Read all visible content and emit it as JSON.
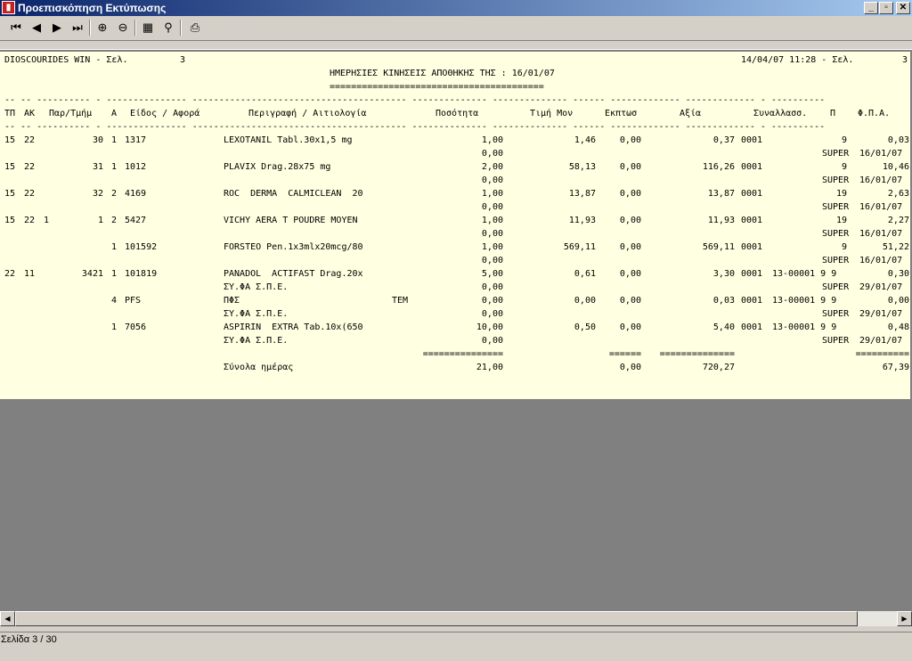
{
  "window": {
    "title": "Προεπισκόπηση Εκτύπωσης",
    "icon": "app-icon",
    "icon_glyph": "▮",
    "controls": {
      "minimize": "_",
      "maximize": "▫",
      "close": "✕"
    }
  },
  "toolbar": {
    "buttons": [
      {
        "name": "first-page-icon",
        "glyph": "⏮"
      },
      {
        "name": "prev-page-icon",
        "glyph": "◀"
      },
      {
        "name": "next-page-icon",
        "glyph": "▶"
      },
      {
        "name": "last-page-icon",
        "glyph": "⏭"
      },
      {
        "name": "zoom-in-icon",
        "glyph": "⊕"
      },
      {
        "name": "zoom-out-icon",
        "glyph": "⊖"
      },
      {
        "name": "find-icon",
        "glyph": "▦"
      },
      {
        "name": "find-next-icon",
        "glyph": "⚲"
      },
      {
        "name": "print-icon",
        "glyph": "⎙"
      }
    ]
  },
  "report": {
    "header_left": "DIOSCOURIDES WIN - Σελ.",
    "header_page": "3",
    "header_right": "14/04/07 11:28 - Σελ.",
    "header_right_page": "3",
    "title": "ΗΜΕΡΗΣΙΕΣ ΚΙΝΗΣΕΙΣ ΑΠΟΘΗΚΗΣ ΤΗΣ : 16/01/07",
    "title_rule": "========================================",
    "dash_row": "-- -- ---------- - --------------- ---------------------------------------- -------------- -------------- ------ ------------- ------------- - ----------",
    "columns": [
      "ΤΠ",
      "ΑΚ",
      "Παρ/Τμήμ",
      "Α",
      "Είδος / Αφορά",
      "Περιγραφή / Αιτιολογία",
      "Ποσότητα",
      "Τιμή Μον",
      "Εκπτωσ",
      "Αξία",
      "Συναλλασσ.",
      "Π",
      "Φ.Π.Α."
    ],
    "rows": [
      {
        "tp": "15",
        "ak": "22",
        "sub": "",
        "par": "30",
        "a": "1",
        "code": "1317",
        "desc": "LEXOTANIL Tabl.30x1,5 mg",
        "extra": "",
        "qty": "1,00",
        "price": "1,46",
        "disc": "0,00",
        "value": "0,37",
        "tx": "0001",
        "tx2": "",
        "p": "9",
        "vat": "0,03",
        "desc2": "",
        "qty2": "0,00",
        "sup": "SUPER",
        "date": "16/01/07"
      },
      {
        "tp": "15",
        "ak": "22",
        "sub": "",
        "par": "31",
        "a": "1",
        "code": "1012",
        "desc": "PLAVIX Drag.28x75 mg",
        "extra": "",
        "qty": "2,00",
        "price": "58,13",
        "disc": "0,00",
        "value": "116,26",
        "tx": "0001",
        "tx2": "",
        "p": "9",
        "vat": "10,46",
        "desc2": "",
        "qty2": "0,00",
        "sup": "SUPER",
        "date": "16/01/07"
      },
      {
        "tp": "15",
        "ak": "22",
        "sub": "",
        "par": "32",
        "a": "2",
        "code": "4169",
        "desc": "ROC  DERMA  CALMICLEAN  20",
        "extra": "",
        "qty": "1,00",
        "price": "13,87",
        "disc": "0,00",
        "value": "13,87",
        "tx": "0001",
        "tx2": "",
        "p": "19",
        "vat": "2,63",
        "desc2": "",
        "qty2": "0,00",
        "sup": "SUPER",
        "date": "16/01/07"
      },
      {
        "tp": "15",
        "ak": "22",
        "sub": "1",
        "par": "1",
        "a": "2",
        "code": "5427",
        "desc": "VICHY AERA T POUDRE MOYEN",
        "extra": "",
        "qty": "1,00",
        "price": "11,93",
        "disc": "0,00",
        "value": "11,93",
        "tx": "0001",
        "tx2": "",
        "p": "19",
        "vat": "2,27",
        "desc2": "",
        "qty2": "0,00",
        "sup": "SUPER",
        "date": "16/01/07"
      },
      {
        "tp": "",
        "ak": "",
        "sub": "",
        "par": "",
        "a": "1",
        "code": "101592",
        "desc": "FORSTEO Pen.1x3mlx20mcg/80",
        "extra": "",
        "qty": "1,00",
        "price": "569,11",
        "disc": "0,00",
        "value": "569,11",
        "tx": "0001",
        "tx2": "",
        "p": "9",
        "vat": "51,22",
        "desc2": "",
        "qty2": "0,00",
        "sup": "SUPER",
        "date": "16/01/07"
      },
      {
        "tp": "22",
        "ak": "11",
        "sub": "",
        "par": "3421",
        "a": "1",
        "code": "101819",
        "desc": "PANADOL  ACTIFAST Drag.20x",
        "extra": "",
        "qty": "5,00",
        "price": "0,61",
        "disc": "0,00",
        "value": "3,30",
        "tx": "0001",
        "tx2": "13-00001 9 9",
        "p": "",
        "vat": "0,30",
        "desc2": "ΣΥ.ΦΑ Σ.Π.Ε.",
        "qty2": "0,00",
        "sup": "SUPER",
        "date": "29/01/07"
      },
      {
        "tp": "",
        "ak": "",
        "sub": "",
        "par": "",
        "a": "4",
        "code": "PFS",
        "desc": "ΠΦΣ",
        "extra": "TEM",
        "qty": "0,00",
        "price": "0,00",
        "disc": "0,00",
        "value": "0,03",
        "tx": "0001",
        "tx2": "13-00001 9 9",
        "p": "",
        "vat": "0,00",
        "desc2": "ΣΥ.ΦΑ Σ.Π.Ε.",
        "qty2": "0,00",
        "sup": "SUPER",
        "date": "29/01/07"
      },
      {
        "tp": "",
        "ak": "",
        "sub": "",
        "par": "",
        "a": "1",
        "code": "7056",
        "desc": "ASPIRIN  EXTRA Tab.10x(650",
        "extra": "",
        "qty": "10,00",
        "price": "0,50",
        "disc": "0,00",
        "value": "5,40",
        "tx": "0001",
        "tx2": "13-00001 9 9",
        "p": "",
        "vat": "0,48",
        "desc2": "ΣΥ.ΦΑ Σ.Π.Ε.",
        "qty2": "0,00",
        "sup": "SUPER",
        "date": "29/01/07"
      }
    ],
    "totals_rule": {
      "qty": "===============",
      "disc": "======",
      "value": "==============",
      "vat": "=========="
    },
    "totals": {
      "label": "Σύνολα ημέρας",
      "qty": "21,00",
      "disc": "0,00",
      "value": "720,27",
      "vat": "67,39"
    }
  },
  "scrollbar": {
    "left_arrow": "◀",
    "right_arrow": "▶"
  },
  "status": {
    "page_text": "Σελίδα 3 / 30"
  }
}
